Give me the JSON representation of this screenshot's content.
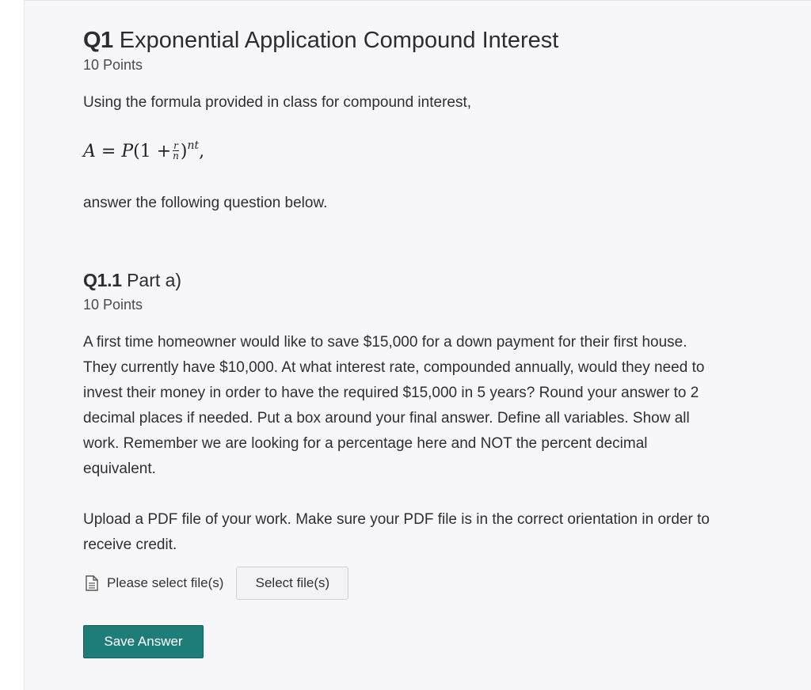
{
  "question": {
    "number": "Q1",
    "title": "Exponential Application Compound Interest",
    "points": "10 Points",
    "intro": "Using the formula provided in class for compound interest,",
    "formula": {
      "lhs": "A",
      "equals": "=",
      "p": "P",
      "open": "(1 +",
      "frac_num": "r",
      "frac_den": "n",
      "close": ")",
      "exponent": "nt",
      "trail": ","
    },
    "follow": "answer the following question below."
  },
  "part": {
    "number": "Q1.1",
    "title": "Part a)",
    "points": "10 Points",
    "body": [
      "A first time homeowner would like to save $15,000 for a down payment for their first house.",
      "They currently have $10,000.  At what interest rate, compounded annually, would they need to",
      "invest their money in order to have the required $15,000 in 5 years? Round your answer to 2",
      "decimal places if needed. Put a box around your final answer. Define all variables. Show all",
      "work. Remember we are looking for a percentage here and NOT the percent decimal",
      "equivalent."
    ],
    "upload": [
      "Upload a PDF file of your work. Make sure your PDF file is in the correct orientation in order to",
      "receive credit."
    ]
  },
  "file_upload": {
    "icon": "document-icon",
    "label": "Please select file(s)",
    "button": "Select file(s)"
  },
  "actions": {
    "save": "Save Answer"
  },
  "colors": {
    "panel_bg": "#f7f7fa",
    "save_bg": "#1f7d79",
    "text": "#2f2f2f"
  }
}
